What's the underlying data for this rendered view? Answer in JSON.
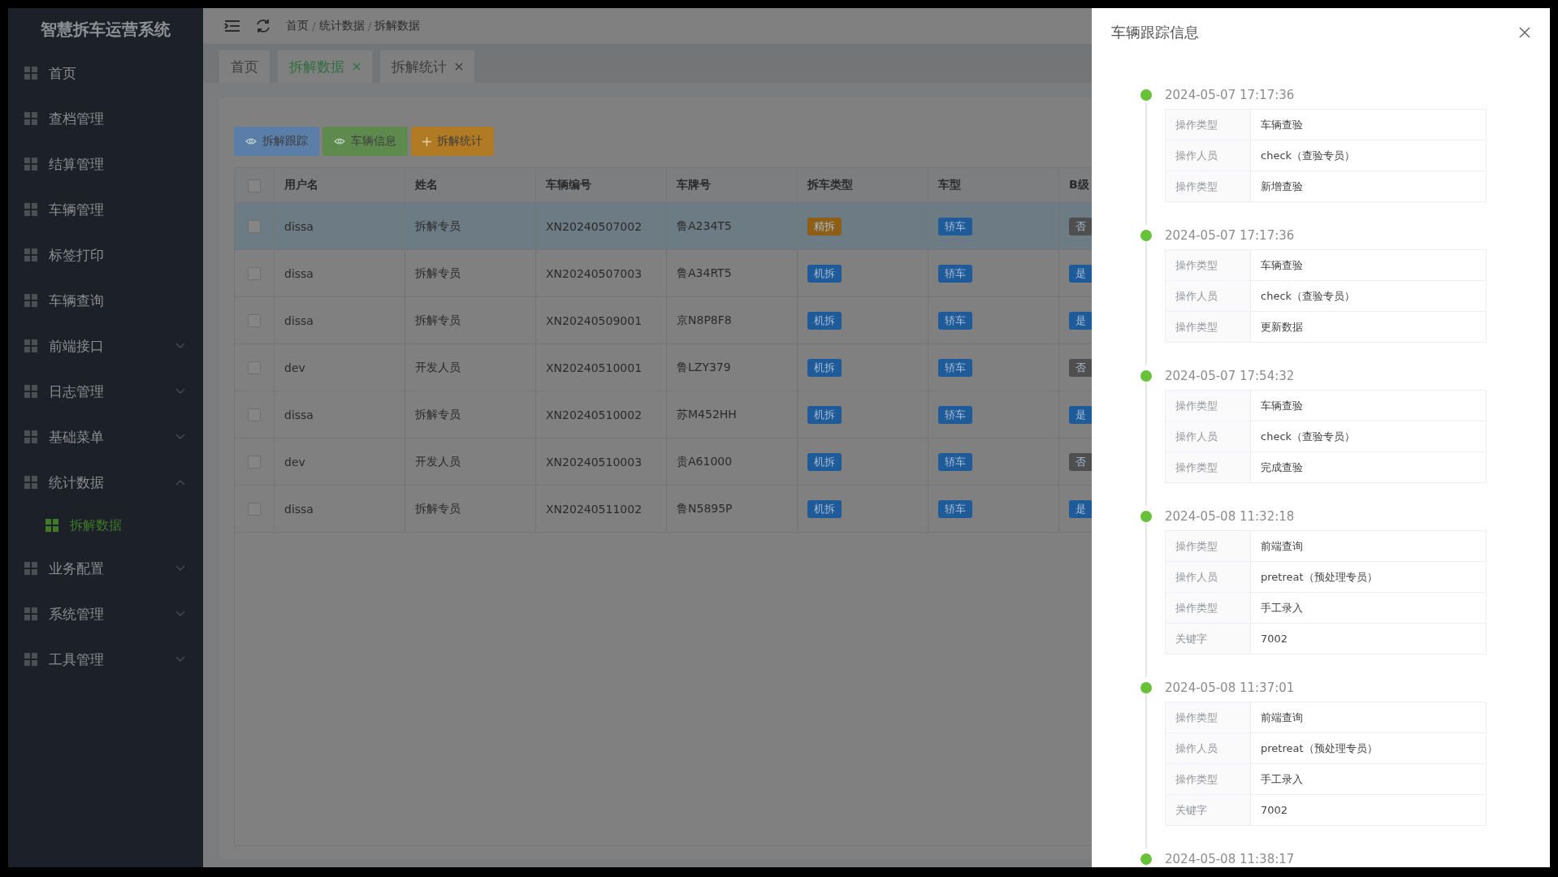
{
  "sidebar": {
    "title": "智慧拆车运营系统",
    "items": [
      {
        "label": "首页"
      },
      {
        "label": "查档管理"
      },
      {
        "label": "结算管理"
      },
      {
        "label": "车辆管理"
      },
      {
        "label": "标签打印"
      },
      {
        "label": "车辆查询"
      },
      {
        "label": "前端接口",
        "expanded": false
      },
      {
        "label": "日志管理",
        "expanded": false
      },
      {
        "label": "基础菜单",
        "expanded": false
      },
      {
        "label": "统计数据",
        "expanded": true,
        "children": [
          {
            "label": "拆解数据",
            "selected": true
          }
        ]
      },
      {
        "label": "业务配置",
        "expanded": false
      },
      {
        "label": "系统管理",
        "expanded": false
      },
      {
        "label": "工具管理",
        "expanded": false
      }
    ]
  },
  "breadcrumb": {
    "separator": "/",
    "items": [
      "首页",
      "统计数据",
      "拆解数据"
    ]
  },
  "tabs": [
    {
      "label": "首页",
      "selected": false,
      "closable": false
    },
    {
      "label": "拆解数据",
      "selected": true,
      "closable": true
    },
    {
      "label": "拆解统计",
      "selected": false,
      "closable": true
    }
  ],
  "toolbar": [
    {
      "label": "拆解跟踪",
      "kind": "view",
      "color": "#5a7ea8"
    },
    {
      "label": "车辆信息",
      "kind": "view",
      "color": "#5e8a4e"
    },
    {
      "label": "拆解统计",
      "kind": "add",
      "color": "#b07b24"
    }
  ],
  "table": {
    "select_all_checked": false,
    "columns": [
      "用户名",
      "姓名",
      "车辆编号",
      "车牌号",
      "拆车类型",
      "车型",
      "B级"
    ],
    "rows": [
      {
        "selected": true,
        "checked": false,
        "cells": [
          "dissa",
          "拆解专员",
          "XN20240507002",
          "鲁A234T5"
        ],
        "type": {
          "text": "精拆",
          "color": "#8c5e16"
        },
        "model": {
          "text": "轿车",
          "color": "#1f5a99"
        },
        "grade": {
          "text": "否",
          "color": "#4f4f4f"
        }
      },
      {
        "selected": false,
        "checked": false,
        "cells": [
          "dissa",
          "拆解专员",
          "XN20240507003",
          "鲁A34RT5"
        ],
        "type": {
          "text": "机拆",
          "color": "#1f5a99"
        },
        "model": {
          "text": "轿车",
          "color": "#1f5a99"
        },
        "grade": {
          "text": "是",
          "color": "#1f5a99"
        }
      },
      {
        "selected": false,
        "checked": false,
        "cells": [
          "dissa",
          "拆解专员",
          "XN20240509001",
          "京N8P8F8"
        ],
        "type": {
          "text": "机拆",
          "color": "#1f5a99"
        },
        "model": {
          "text": "轿车",
          "color": "#1f5a99"
        },
        "grade": {
          "text": "是",
          "color": "#1f5a99"
        }
      },
      {
        "selected": false,
        "checked": false,
        "cells": [
          "dev",
          "开发人员",
          "XN20240510001",
          "鲁LZY379"
        ],
        "type": {
          "text": "机拆",
          "color": "#1f5a99"
        },
        "model": {
          "text": "轿车",
          "color": "#1f5a99"
        },
        "grade": {
          "text": "否",
          "color": "#4f4f4f"
        }
      },
      {
        "selected": false,
        "checked": false,
        "cells": [
          "dissa",
          "拆解专员",
          "XN20240510002",
          "苏M452HH"
        ],
        "type": {
          "text": "机拆",
          "color": "#1f5a99"
        },
        "model": {
          "text": "轿车",
          "color": "#1f5a99"
        },
        "grade": {
          "text": "是",
          "color": "#1f5a99"
        }
      },
      {
        "selected": false,
        "checked": false,
        "cells": [
          "dev",
          "开发人员",
          "XN20240510003",
          "贵A61000"
        ],
        "type": {
          "text": "机拆",
          "color": "#1f5a99"
        },
        "model": {
          "text": "轿车",
          "color": "#1f5a99"
        },
        "grade": {
          "text": "否",
          "color": "#4f4f4f"
        }
      },
      {
        "selected": false,
        "checked": false,
        "cells": [
          "dissa",
          "拆解专员",
          "XN20240511002",
          "鲁N5895P"
        ],
        "type": {
          "text": "机拆",
          "color": "#1f5a99"
        },
        "model": {
          "text": "轿车",
          "color": "#1f5a99"
        },
        "grade": {
          "text": "是",
          "color": "#1f5a99"
        }
      }
    ]
  },
  "drawer": {
    "title": "车辆跟踪信息",
    "timeline": [
      {
        "time": "2024-05-07 17:17:36",
        "rows": [
          [
            "操作类型",
            "车辆查验"
          ],
          [
            "操作人员",
            "check（查验专员）"
          ],
          [
            "操作类型",
            "新增查验"
          ]
        ]
      },
      {
        "time": "2024-05-07 17:17:36",
        "rows": [
          [
            "操作类型",
            "车辆查验"
          ],
          [
            "操作人员",
            "check（查验专员）"
          ],
          [
            "操作类型",
            "更新数据"
          ]
        ]
      },
      {
        "time": "2024-05-07 17:54:32",
        "rows": [
          [
            "操作类型",
            "车辆查验"
          ],
          [
            "操作人员",
            "check（查验专员）"
          ],
          [
            "操作类型",
            "完成查验"
          ]
        ]
      },
      {
        "time": "2024-05-08 11:32:18",
        "rows": [
          [
            "操作类型",
            "前端查询"
          ],
          [
            "操作人员",
            "pretreat（预处理专员）"
          ],
          [
            "操作类型",
            "手工录入"
          ],
          [
            "关键字",
            "7002"
          ]
        ]
      },
      {
        "time": "2024-05-08 11:37:01",
        "rows": [
          [
            "操作类型",
            "前端查询"
          ],
          [
            "操作人员",
            "pretreat（预处理专员）"
          ],
          [
            "操作类型",
            "手工录入"
          ],
          [
            "关键字",
            "7002"
          ]
        ]
      },
      {
        "time": "2024-05-08 11:38:17"
      }
    ]
  }
}
